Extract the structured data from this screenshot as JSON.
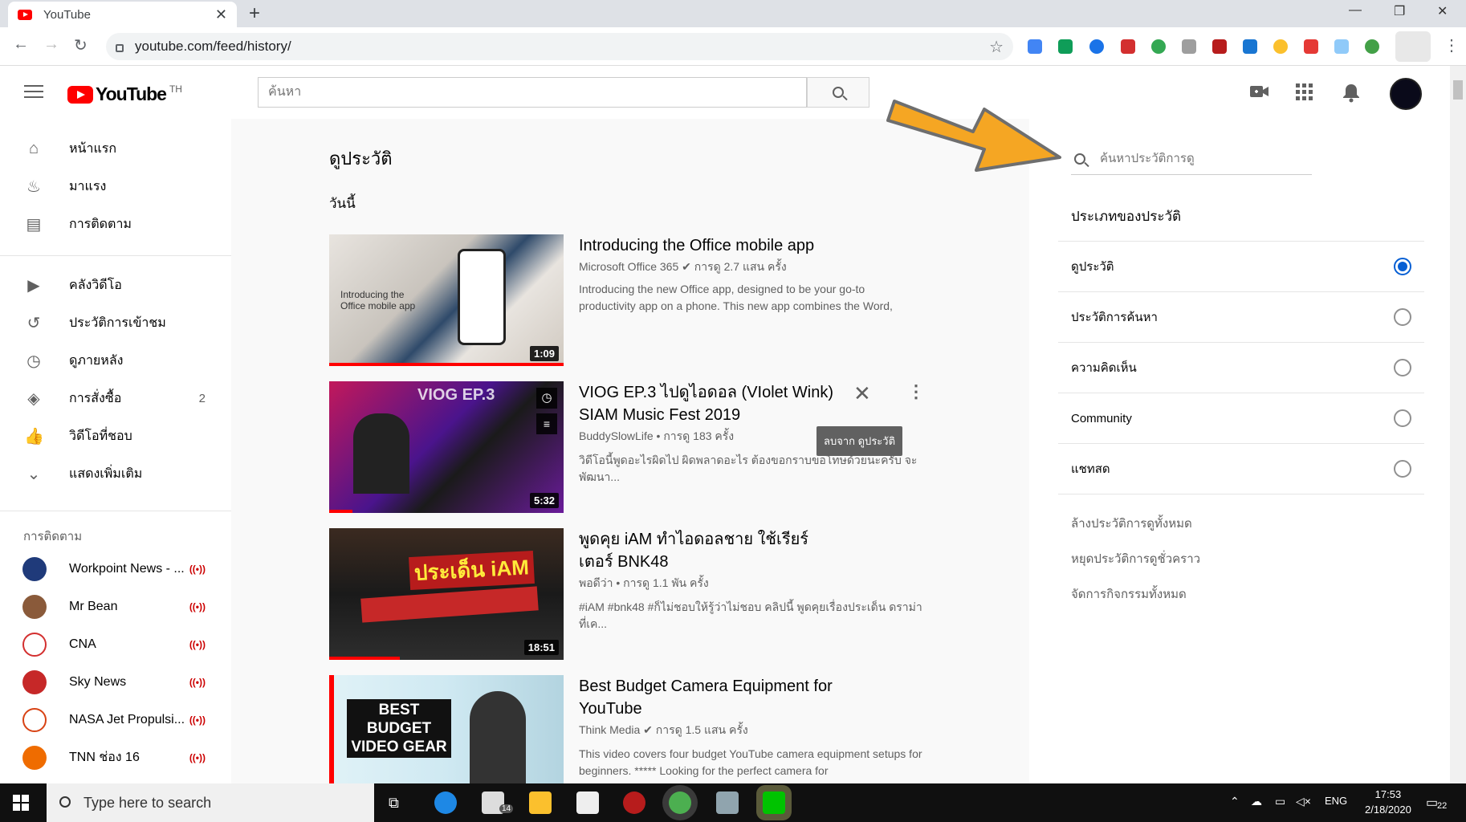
{
  "browser": {
    "tab_title": "YouTube",
    "url": "youtube.com/feed/history/"
  },
  "masthead": {
    "logo_text": "YouTube",
    "country": "TH",
    "search_placeholder": "ค้นหา"
  },
  "sidebar": {
    "main": [
      {
        "label": "หน้าแรก",
        "icon": "home-icon"
      },
      {
        "label": "มาแรง",
        "icon": "trending-icon"
      },
      {
        "label": "การติดตาม",
        "icon": "subscriptions-icon"
      }
    ],
    "library": [
      {
        "label": "คลังวิดีโอ",
        "icon": "library-icon"
      },
      {
        "label": "ประวัติการเข้าชม",
        "icon": "history-icon"
      },
      {
        "label": "ดูภายหลัง",
        "icon": "watch-later-icon"
      },
      {
        "label": "การสั่งซื้อ",
        "icon": "purchases-icon",
        "count": "2"
      },
      {
        "label": "วิดีโอที่ชอบ",
        "icon": "liked-icon"
      },
      {
        "label": "แสดงเพิ่มเติม",
        "icon": "chevron-down-icon"
      }
    ],
    "subs_heading": "การติดตาม",
    "channels": [
      {
        "name": "Workpoint News - ...",
        "color": "#1f3a7a"
      },
      {
        "name": "Mr Bean",
        "color": "#8a5a3a"
      },
      {
        "name": "CNA",
        "color": "#d32f2f"
      },
      {
        "name": "Sky News",
        "color": "#c62828"
      },
      {
        "name": "NASA Jet Propulsi...",
        "color": "#d84315"
      },
      {
        "name": "TNN ช่อง 16",
        "color": "#ef6c00"
      }
    ]
  },
  "main": {
    "page_title": "ดูประวัติ",
    "section_label": "วันนี้",
    "videos": [
      {
        "title": "Introducing the Office mobile app",
        "channel": "Microsoft Office 365",
        "verified": true,
        "views": "การดู 2.7 แสน ครั้ง",
        "description": "Introducing the new Office app, designed to be your go-to productivity app on a phone. This new app combines the Word,",
        "duration": "1:09",
        "progress": 1.0,
        "thumb_text": "Introducing the Office mobile app"
      },
      {
        "title": "VIOG EP.3 ไปดูไอดอล (VIolet Wink) SIAM Music Fest 2019",
        "channel": "BuddySlowLife",
        "verified": false,
        "views": "การดู 183 ครั้ง",
        "description": "วิดีโอนี้พูดอะไรผิดไป ผิดพลาดอะไร ต้องขอกราบขอโทษด้วยนะครับ จะพัฒนา...",
        "duration": "5:32",
        "progress": 0.1,
        "thumb_text": "VIOG EP.3",
        "remove_tooltip": "ลบจาก ดูประวัติ"
      },
      {
        "title": "พูดคุย iAM ทำไอดอลชาย ใช้เรียร์ เตอร์ BNK48",
        "channel": "พอดีว่า",
        "verified": false,
        "views": "การดู 1.1 พัน ครั้ง",
        "description": "#iAM #bnk48 #ก็ไม่ชอบให้รู้ว่าไม่ชอบ คลิปนี้ พูดคุยเรื่องประเด็น ดราม่าที่เค...",
        "duration": "18:51",
        "progress": 0.3,
        "thumb_text": "ประเด็น iAM"
      },
      {
        "title": "Best Budget Camera Equipment for YouTube",
        "channel": "Think Media",
        "verified": true,
        "views": "การดู 1.5 แสน ครั้ง",
        "description": "This video covers four budget YouTube camera equipment setups for beginners. ***** Looking for the perfect camera for",
        "duration": "",
        "progress": 0.02,
        "thumb_text": "BEST BUDGET VIDEO GEAR"
      }
    ]
  },
  "history_panel": {
    "search_placeholder": "ค้นหาประวัติการดู",
    "type_heading": "ประเภทของประวัติ",
    "types": [
      {
        "label": "ดูประวัติ",
        "selected": true
      },
      {
        "label": "ประวัติการค้นหา",
        "selected": false
      },
      {
        "label": "ความคิดเห็น",
        "selected": false
      },
      {
        "label": "Community",
        "selected": false
      },
      {
        "label": "แชทสด",
        "selected": false
      }
    ],
    "links": [
      "ล้างประวัติการดูทั้งหมด",
      "หยุดประวัติการดูชั่วคราว",
      "จัดการกิจกรรมทั้งหมด"
    ]
  },
  "taskbar": {
    "search_text": "Type here to search",
    "mail_badge": "14",
    "lang": "ENG",
    "time": "17:53",
    "date": "2/18/2020",
    "notif_count": "22"
  },
  "colors": {
    "accent": "#065fd4",
    "brand": "#ff0000",
    "arrow": "#f5a623"
  }
}
